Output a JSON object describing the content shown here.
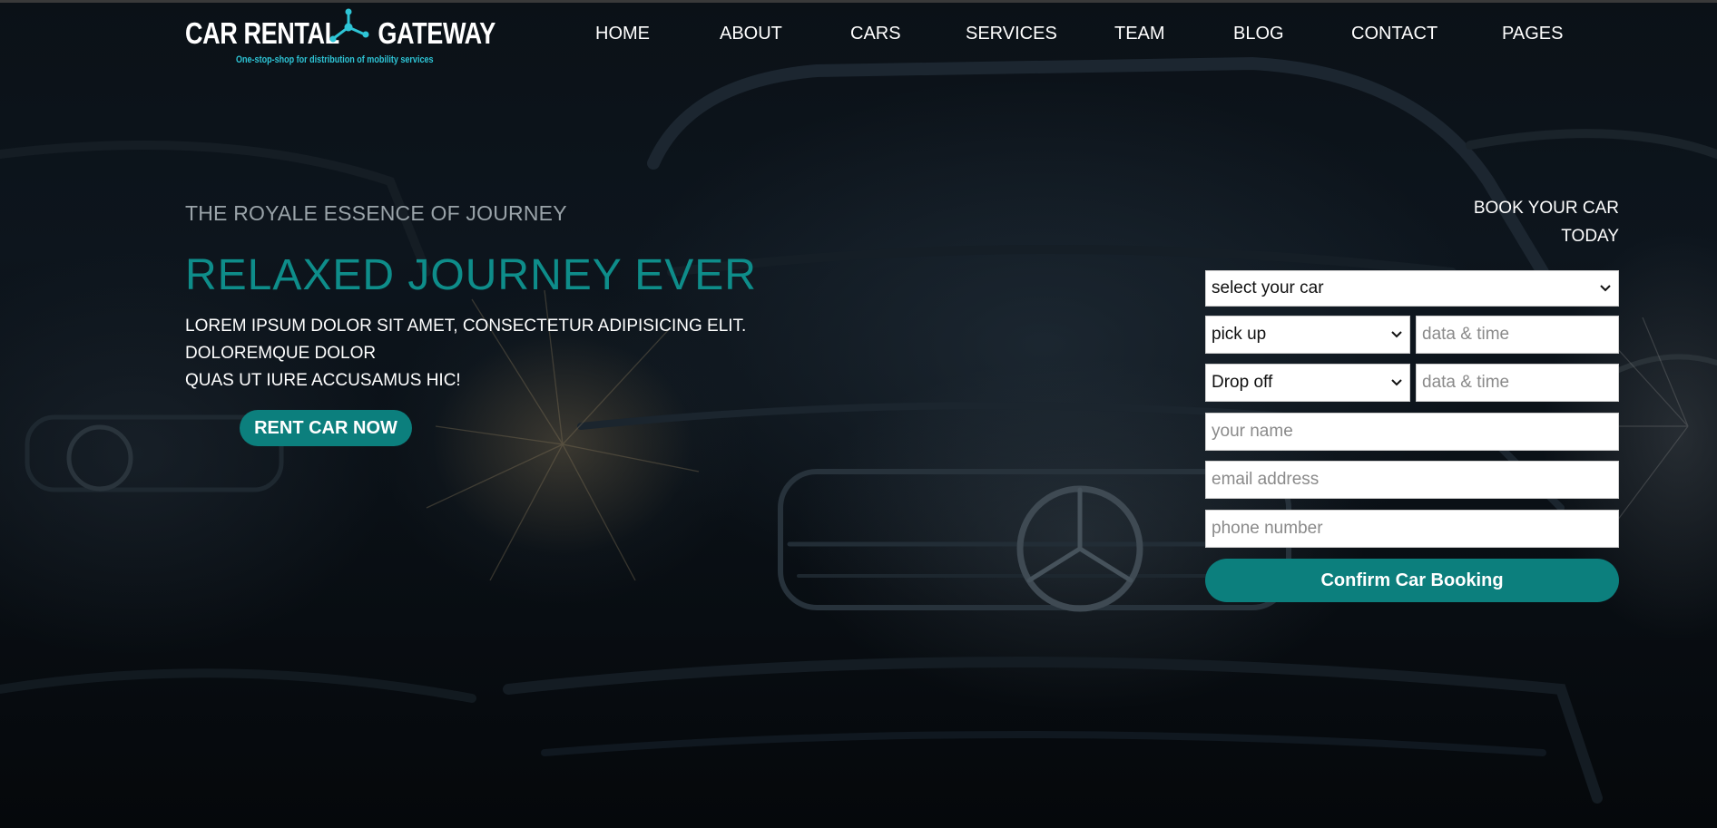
{
  "brand": {
    "name_left": "CAR RENTAL",
    "name_right": "GATEWAY",
    "tagline": "One-stop-shop for distribution of mobility services",
    "accent": "#2ec5d6",
    "logo_icon": "network-node-icon"
  },
  "nav": {
    "items": [
      {
        "label": "HOME"
      },
      {
        "label": "ABOUT"
      },
      {
        "label": "CARS"
      },
      {
        "label": "SERVICES"
      },
      {
        "label": "TEAM"
      },
      {
        "label": "BLOG"
      },
      {
        "label": "CONTACT"
      },
      {
        "label": "PAGES"
      }
    ]
  },
  "hero": {
    "eyebrow": "THE ROYALE ESSENCE OF JOURNEY",
    "headline": "RELAXED JOURNEY EVER",
    "lead_line1": "LOREM IPSUM DOLOR SIT AMET, CONSECTETUR ADIPISICING ELIT. DOLOREMQUE DOLOR",
    "lead_line2": "QUAS UT IURE ACCUSAMUS HIC!",
    "cta_label": "RENT CAR NOW",
    "headline_color": "#0e8d8a",
    "button_color": "#0c7f7d"
  },
  "booking": {
    "title_line1": "BOOK YOUR CAR",
    "title_line2": "TODAY",
    "car_select": "select your car",
    "pickup_select": "pick up",
    "pickup_datetime_placeholder": "data & time",
    "dropoff_select": "Drop off",
    "dropoff_datetime_placeholder": "data & time",
    "name_placeholder": "your name",
    "email_placeholder": "email address",
    "phone_placeholder": "phone number",
    "confirm_label": "Confirm Car Booking"
  }
}
